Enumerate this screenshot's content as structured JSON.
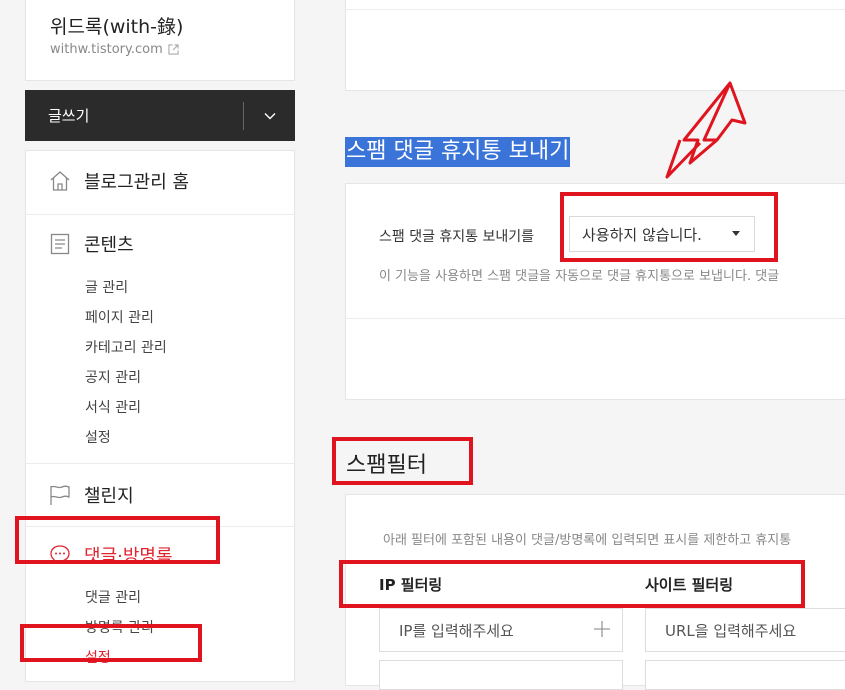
{
  "blog": {
    "title": "위드록(with-錄)",
    "url": "withw.tistory.com"
  },
  "write": {
    "label": "글쓰기"
  },
  "nav": {
    "home": {
      "label": "블로그관리 홈",
      "icon": "home-icon"
    },
    "content": {
      "label": "콘텐츠",
      "icon": "document-icon",
      "items": [
        "글 관리",
        "페이지 관리",
        "카테고리 관리",
        "공지 관리",
        "서식 관리",
        "설정"
      ]
    },
    "challenge": {
      "label": "챌린지",
      "icon": "flag-icon"
    },
    "comment": {
      "label": "댓글·방명록",
      "icon": "speech-bubble-icon",
      "items": [
        "댓글 관리",
        "방명록 관리",
        "설정"
      ],
      "active_index": 2
    }
  },
  "spam_trash": {
    "title": "스팸 댓글 휴지통 보내기",
    "field_label": "스팸 댓글 휴지통 보내기를",
    "select_value": "사용하지 않습니다.",
    "description": "이 기능을 사용하면 스팸 댓글을 자동으로 댓글 휴지통으로 보냅니다. 댓글"
  },
  "spam_filter": {
    "title": "스팸필터",
    "description": "아래 필터에 포함된 내용이 댓글/방명록에 입력되면 표시를 제한하고 휴지통",
    "ip": {
      "heading": "IP 필터링",
      "placeholder": "IP를 입력해주세요"
    },
    "site": {
      "heading": "사이트 필터링",
      "placeholder": "URL을 입력해주세요"
    }
  },
  "colors": {
    "accent_red": "#e0262f",
    "annotation_red": "#e0141e",
    "highlight_blue": "#3b74d8",
    "write_bar": "#2b2b2b"
  }
}
